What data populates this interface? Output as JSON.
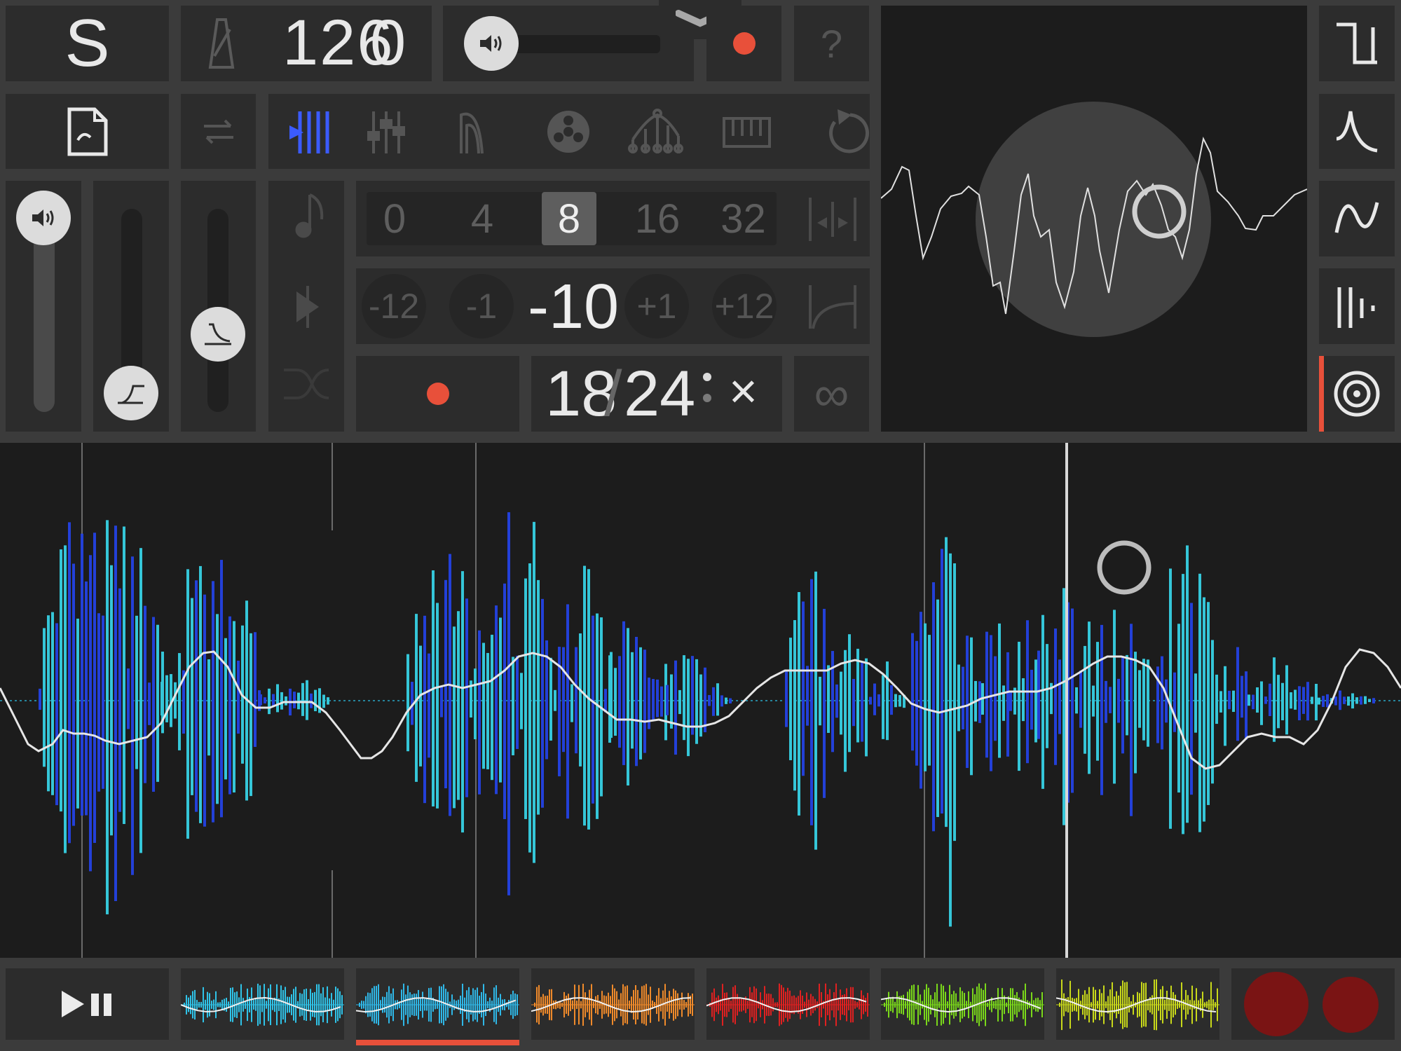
{
  "header": {
    "logo": "S",
    "tempo": "126",
    "tempo_decimal": "0",
    "help": "?"
  },
  "grid": {
    "options": [
      "0",
      "4",
      "8",
      "16",
      "32"
    ],
    "selected": "8"
  },
  "pitch": {
    "buttons": [
      "-12",
      "-1",
      "+1",
      "+12"
    ],
    "value": "-10"
  },
  "loop": {
    "current": "18",
    "separator": "/",
    "total": "24",
    "multiply": "×",
    "infinite": "∞"
  },
  "colors": {
    "accent_red": "#e8503a",
    "accent_blue": "#3b5bff",
    "waveform_blue": "#2340d8",
    "waveform_cyan": "#35c6d8",
    "clip_dark_red": "#7a1414"
  },
  "tools": [
    "tool-grid-icon",
    "tool-mixer-icon",
    "tool-envelope-icon",
    "tool-reel-icon",
    "tool-eq-icon",
    "tool-keyboard-icon",
    "tool-loop-icon"
  ],
  "waveform_shapes": [
    "square-wave-icon",
    "bell-curve-icon",
    "sine-wave-icon",
    "pulse-bars-icon",
    "target-icon"
  ],
  "clips": [
    {
      "name": "clip-1",
      "color": "#2fc3e8"
    },
    {
      "name": "clip-2",
      "color": "#2fb8e8",
      "selected": true
    },
    {
      "name": "clip-3",
      "color": "#f08a2a"
    },
    {
      "name": "clip-4",
      "color": "#e02020"
    },
    {
      "name": "clip-5",
      "color": "#7ad81a"
    },
    {
      "name": "clip-6",
      "color": "#c8d81a"
    }
  ]
}
